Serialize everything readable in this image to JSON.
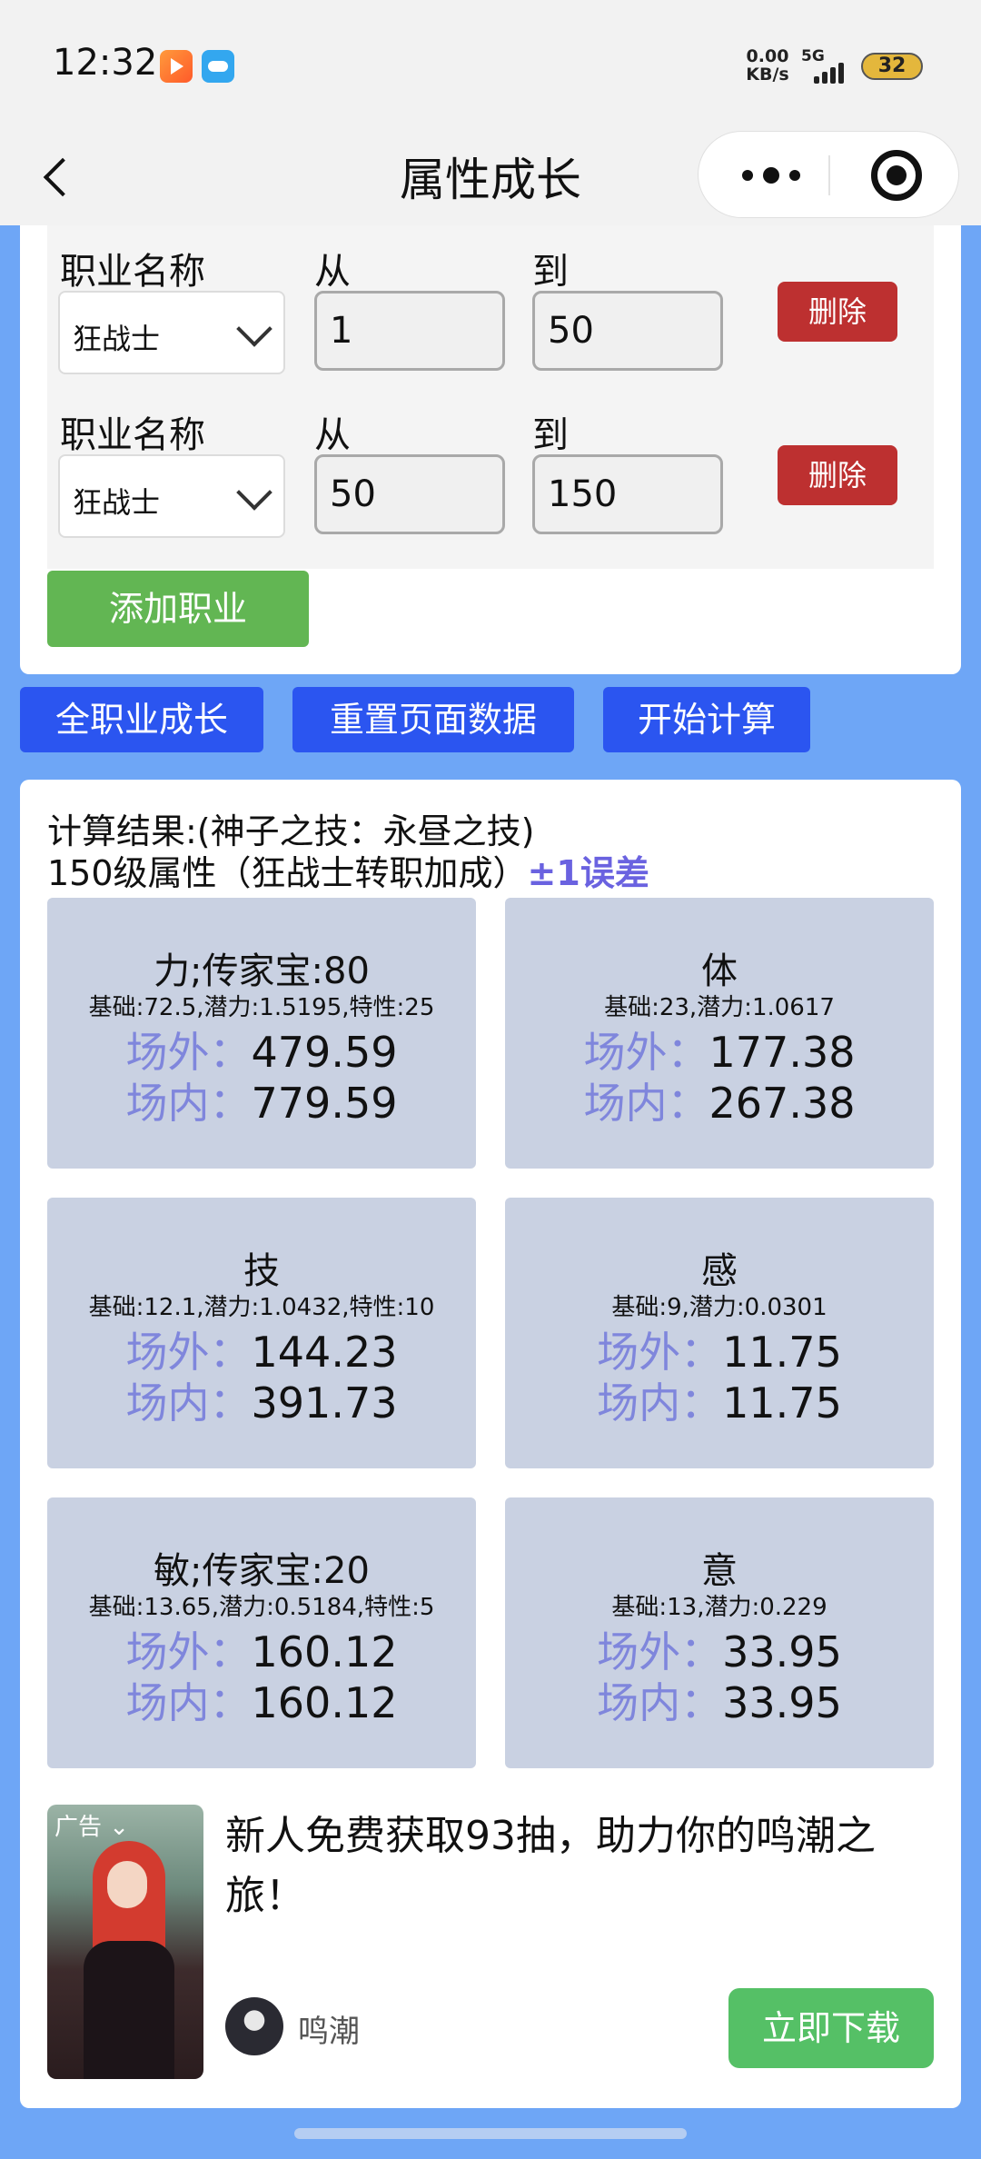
{
  "status_bar": {
    "time": "12:32",
    "speed_value": "0.00",
    "speed_unit": "KB/s",
    "network": "5G",
    "battery": "32"
  },
  "nav": {
    "title": "属性成长"
  },
  "jobs": [
    {
      "label_job": "职业名称",
      "job": "狂战士",
      "label_from": "从",
      "from": "1",
      "label_to": "到",
      "to": "50",
      "delete": "删除"
    },
    {
      "label_job": "职业名称",
      "job": "狂战士",
      "label_from": "从",
      "from": "50",
      "label_to": "到",
      "to": "150",
      "delete": "删除"
    }
  ],
  "add_job": "添加职业",
  "toolbar": {
    "all_jobs": "全职业成长",
    "reset": "重置页面数据",
    "calculate": "开始计算"
  },
  "results": {
    "title": "计算结果:(神子之技：永昼之技)",
    "subtitle": "150级属性（狂战士转职加成）",
    "error": "±1误差",
    "out_key": "场外：",
    "in_key": "场内：",
    "stats": [
      {
        "name": "力;传家宝:80",
        "base": "基础:72.5,潜力:1.5195,特性:25",
        "out": "479.59",
        "in": "779.59"
      },
      {
        "name": "体",
        "base": "基础:23,潜力:1.0617",
        "out": "177.38",
        "in": "267.38"
      },
      {
        "name": "技",
        "base": "基础:12.1,潜力:1.0432,特性:10",
        "out": "144.23",
        "in": "391.73"
      },
      {
        "name": "感",
        "base": "基础:9,潜力:0.0301",
        "out": "11.75",
        "in": "11.75"
      },
      {
        "name": "敏;传家宝:20",
        "base": "基础:13.65,潜力:0.5184,特性:5",
        "out": "160.12",
        "in": "160.12"
      },
      {
        "name": "意",
        "base": "基础:13,潜力:0.229",
        "out": "33.95",
        "in": "33.95"
      }
    ]
  },
  "ad": {
    "tag": "广告 ⌄",
    "text": "新人免费获取93抽，助力你的鸣潮之旅！",
    "brand": "鸣潮",
    "button": "立即下载"
  }
}
